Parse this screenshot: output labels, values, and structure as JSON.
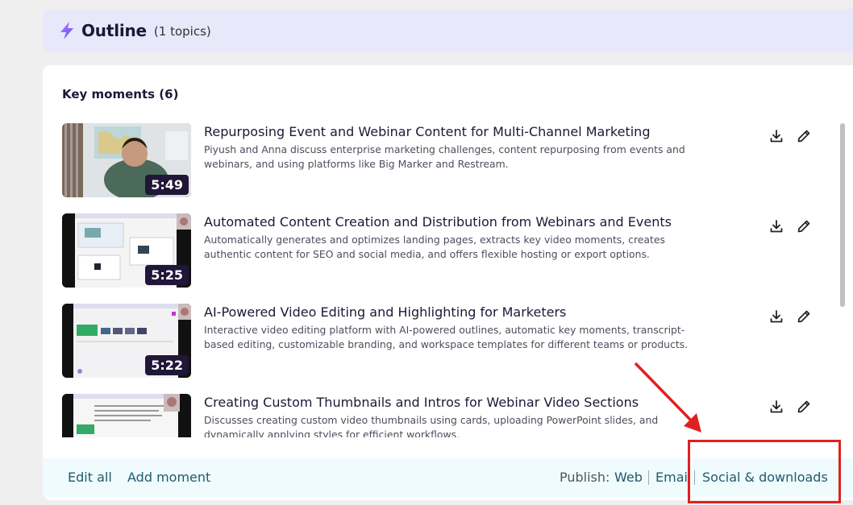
{
  "outline": {
    "title": "Outline",
    "count": "(1 topics)"
  },
  "key_moments": {
    "heading": "Key moments (6)",
    "items": [
      {
        "title": "Repurposing Event and Webinar Content for Multi-Channel Marketing",
        "description": "Piyush and Anna discuss enterprise marketing challenges, content repurposing from events and webinars, and using platforms like Big Marker and Restream.",
        "duration": "5:49"
      },
      {
        "title": "Automated Content Creation and Distribution from Webinars and Events",
        "description": "Automatically generates and optimizes landing pages, extracts key video moments, creates authentic content for SEO and social media, and offers flexible hosting or export options.",
        "duration": "5:25"
      },
      {
        "title": "AI-Powered Video Editing and Highlighting for Marketers",
        "description": "Interactive video editing platform with AI-powered outlines, automatic key moments, transcript-based editing, customizable branding, and workspace templates for different teams or products.",
        "duration": "5:22"
      },
      {
        "title": "Creating Custom Thumbnails and Intros for Webinar Video Sections",
        "description": "Discusses creating custom video thumbnails using cards, uploading PowerPoint slides, and dynamically applying styles for efficient workflows.",
        "duration": ""
      }
    ]
  },
  "footer": {
    "edit_all": "Edit all",
    "add_moment": "Add moment",
    "publish_label": "Publish:",
    "web": "Web",
    "email": "Email",
    "social": "Social & downloads"
  },
  "icons": {
    "bolt": "lightning-icon",
    "download": "download-icon",
    "edit": "pencil-icon"
  },
  "colors": {
    "accent": "#7b5cf5",
    "annotation": "#e02020",
    "link": "#1f5a6e"
  }
}
